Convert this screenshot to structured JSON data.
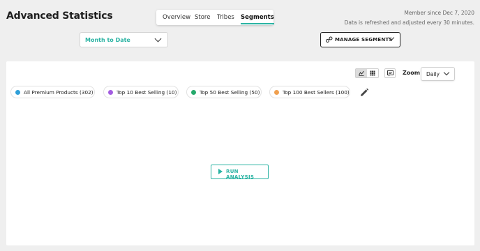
{
  "header": {
    "title": "Advanced Statistics",
    "member_since": "Member since Dec 7, 2020",
    "refresh_note": "Data is refreshed and adjusted every 30 minutes."
  },
  "tabs": [
    {
      "label": "Overview",
      "active": false
    },
    {
      "label": "Store",
      "active": false
    },
    {
      "label": "Tribes",
      "active": false
    },
    {
      "label": "Segments",
      "active": true
    }
  ],
  "date_range": {
    "selected": "Month to Date"
  },
  "manage_segments": {
    "label": "MANAGE SEGMENTS"
  },
  "toolbar": {
    "zoom_label": "Zoom",
    "zoom_selected": "Daily",
    "view_modes": [
      "chart-icon",
      "grid-icon"
    ],
    "active_view": "chart-icon"
  },
  "segments": [
    {
      "label": "All Premium Products (302)",
      "color": "#2f9fd8"
    },
    {
      "label": "Top 10 Best Selling (10)",
      "color": "#a35de0"
    },
    {
      "label": "Top 50 Best Selling (50)",
      "color": "#26a96c"
    },
    {
      "label": "Top 100 Best Sellers (100)",
      "color": "#f0a050"
    }
  ],
  "run_button": {
    "label": "RUN ANALYSIS"
  },
  "colors": {
    "accent": "#2ab3a3"
  }
}
